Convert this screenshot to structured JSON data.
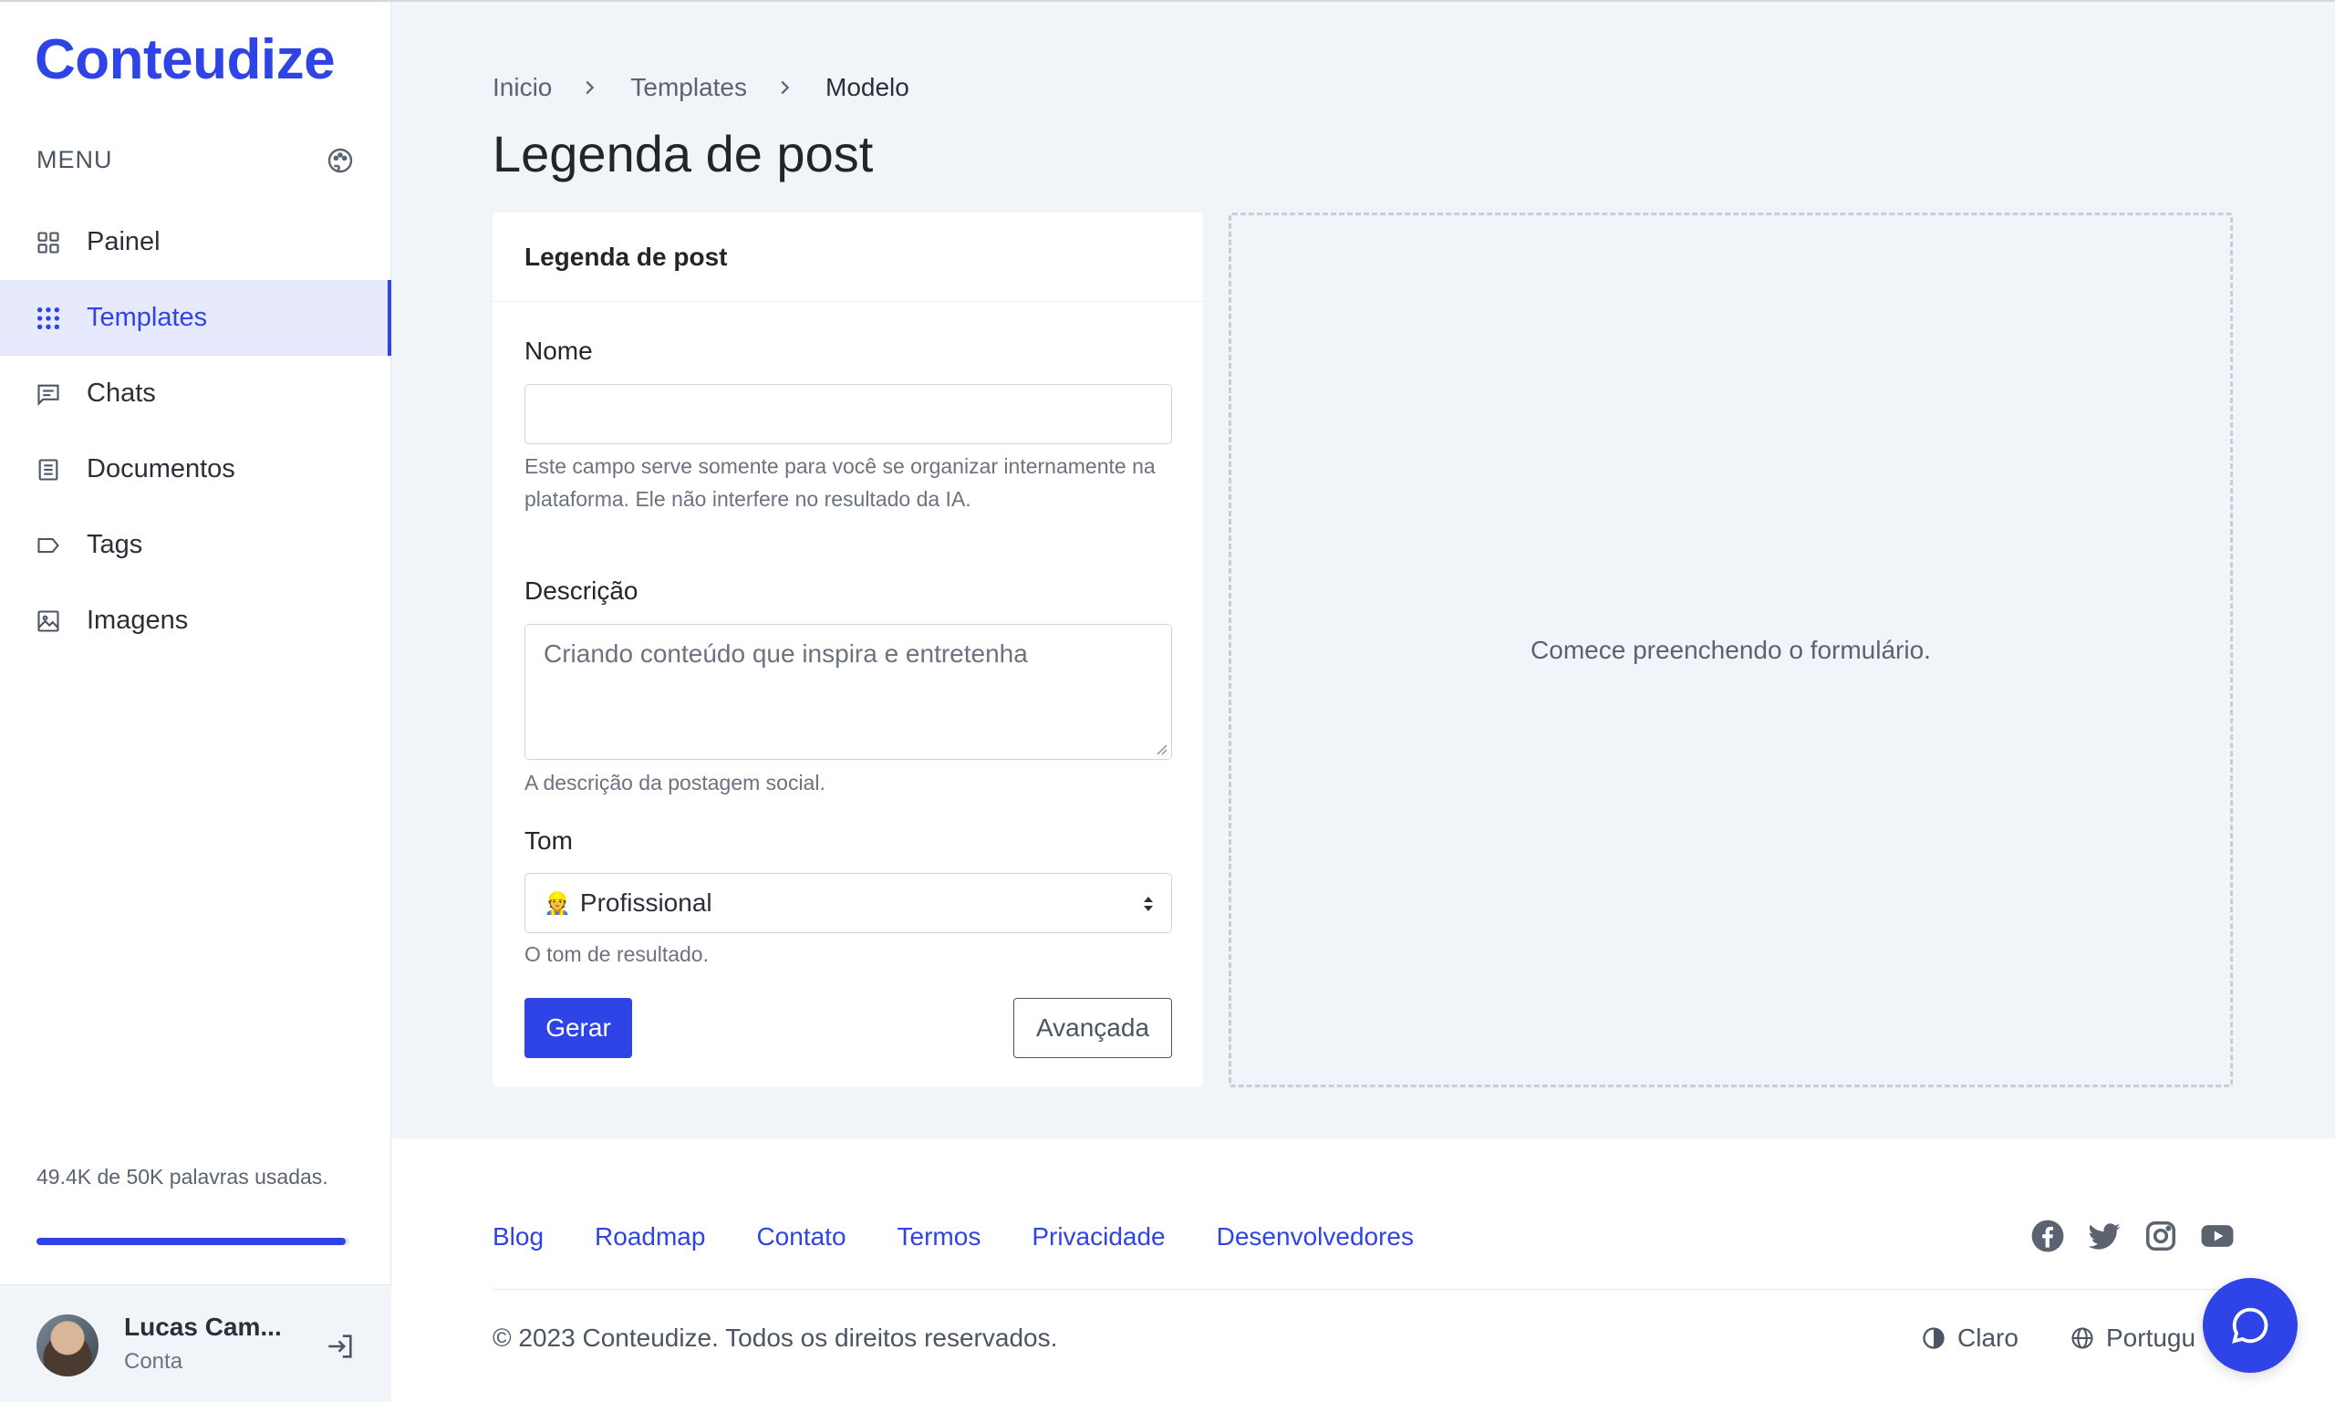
{
  "sidebar": {
    "logo": "Conteudize",
    "menu_label": "MENU",
    "items": [
      {
        "label": "Painel",
        "icon": "grid-icon",
        "active": false
      },
      {
        "label": "Templates",
        "icon": "apps-icon",
        "active": true
      },
      {
        "label": "Chats",
        "icon": "chat-icon",
        "active": false
      },
      {
        "label": "Documentos",
        "icon": "document-icon",
        "active": false
      },
      {
        "label": "Tags",
        "icon": "tag-icon",
        "active": false
      },
      {
        "label": "Imagens",
        "icon": "image-icon",
        "active": false
      }
    ],
    "usage_text": "49.4K de 50K palavras usadas.",
    "usage_fraction": 0.988,
    "user": {
      "name": "Lucas Cam...",
      "subtitle": "Conta"
    }
  },
  "breadcrumb": [
    "Inicio",
    "Templates",
    "Modelo"
  ],
  "page_title": "Legenda de post",
  "form": {
    "card_title": "Legenda de post",
    "name_label": "Nome",
    "name_value": "",
    "name_help": "Este campo serve somente para você se organizar internamente na plataforma. Ele não interfere no resultado da IA.",
    "description_label": "Descrição",
    "description_placeholder": "Criando conteúdo que inspira e entretenha",
    "description_help": "A descrição da postagem social.",
    "tone_label": "Tom",
    "tone_emoji": "👷",
    "tone_value": "Profissional",
    "tone_help": "O tom de resultado.",
    "generate_label": "Gerar",
    "advanced_label": "Avançada"
  },
  "result_placeholder": "Comece preenchendo o formulário.",
  "footer": {
    "links": [
      "Blog",
      "Roadmap",
      "Contato",
      "Termos",
      "Privacidade",
      "Desenvolvedores"
    ],
    "social": [
      "facebook-icon",
      "twitter-icon",
      "instagram-icon",
      "youtube-icon"
    ],
    "copyright": "© 2023 Conteudize. Todos os direitos reservados.",
    "theme_label": "Claro",
    "language_label": "Portugu"
  },
  "colors": {
    "accent": "#2f44e6",
    "background": "#f1f4f9"
  }
}
